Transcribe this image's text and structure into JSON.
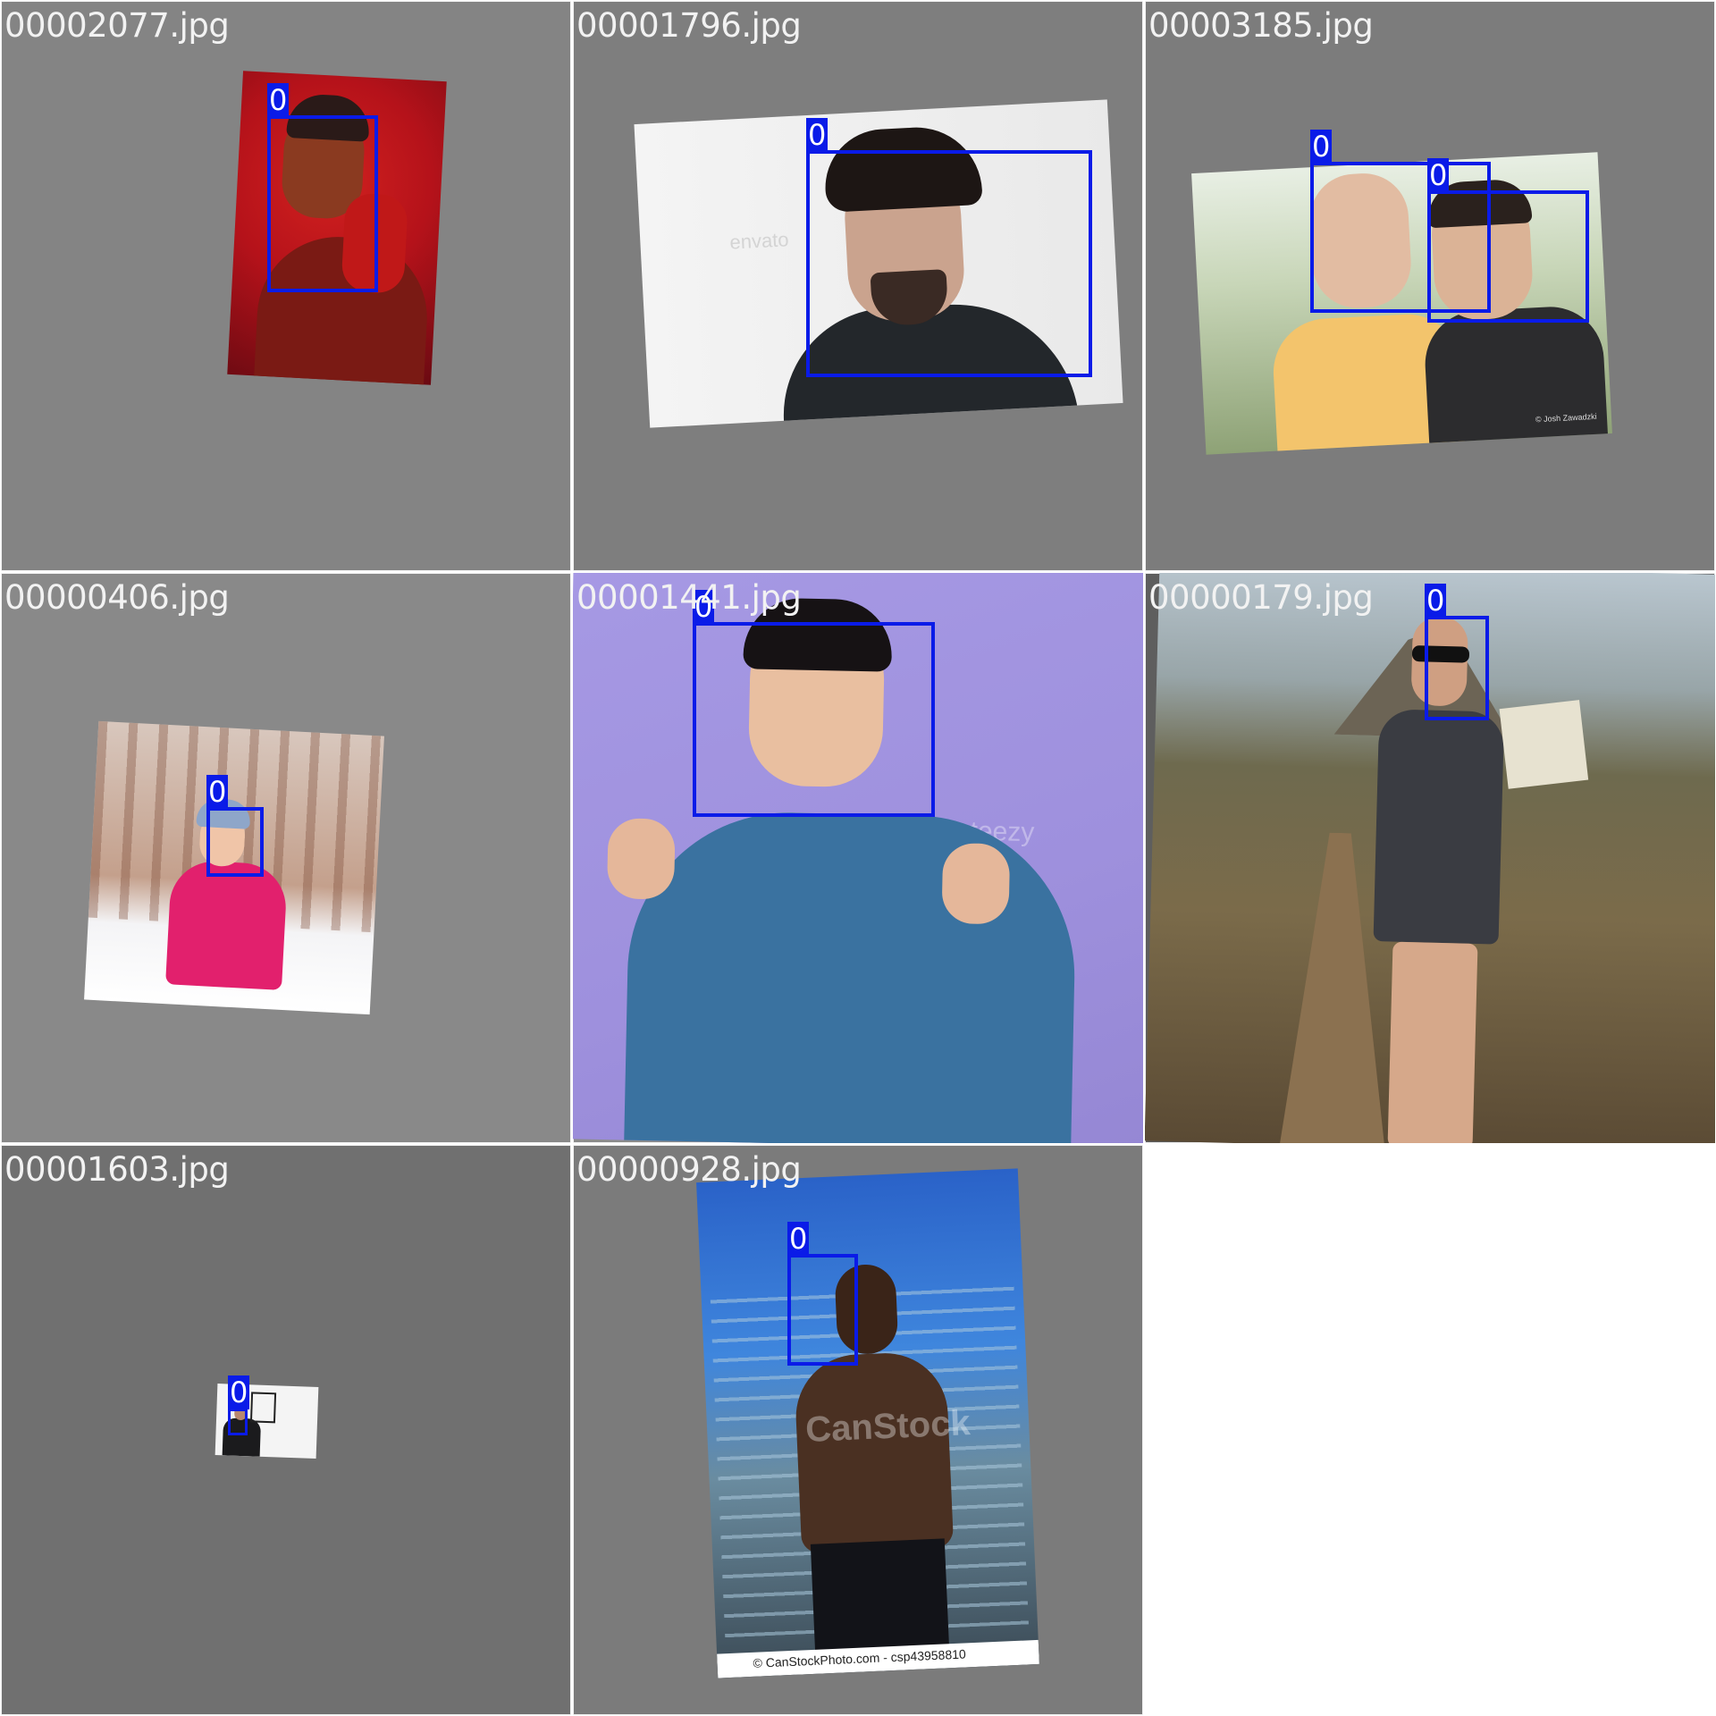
{
  "tiles": [
    {
      "filename": "00002077.jpg",
      "box_label": "0"
    },
    {
      "filename": "00001796.jpg",
      "box_label": "0",
      "watermark": "envato"
    },
    {
      "filename": "00003185.jpg",
      "box_labels": [
        "0",
        "0"
      ],
      "credit": "© Josh Zawadzki"
    },
    {
      "filename": "00000406.jpg",
      "box_label": "0"
    },
    {
      "filename": "00001441.jpg",
      "box_label": "0",
      "watermark": "Vecteezy"
    },
    {
      "filename": "00000179.jpg",
      "box_label": "0"
    },
    {
      "filename": "00001603.jpg",
      "box_label": "0"
    },
    {
      "filename": "00000928.jpg",
      "box_label": "0",
      "watermark": "CanStock",
      "caption": "© CanStockPhoto.com - csp43958810"
    }
  ],
  "colors": {
    "box": "#0a1be8",
    "tile_background": "#7f7f7f"
  }
}
